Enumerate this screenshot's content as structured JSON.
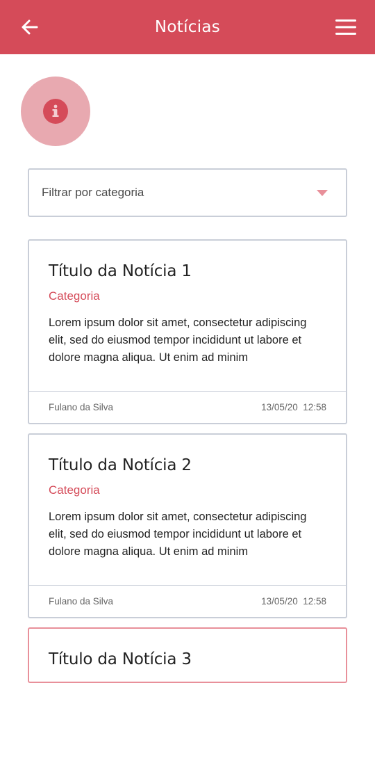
{
  "header": {
    "title": "Notícias",
    "back_icon": "arrow-left-icon",
    "menu_icon": "hamburger-menu-icon",
    "color": "#d54b59"
  },
  "info_button": {
    "icon": "info-icon"
  },
  "filter": {
    "placeholder": "Filtrar por categoria",
    "icon": "caret-down-icon"
  },
  "news": [
    {
      "title": "Título da Notícia 1",
      "category": "Categoria",
      "excerpt": "Lorem ipsum dolor sit amet, consectetur adipiscing elit, sed do eiusmod tempor incididunt ut labore et dolore magna aliqua. Ut enim ad minim",
      "author": "Fulano da Silva",
      "date": "13/05/20  12:58"
    },
    {
      "title": "Título da Notícia 2",
      "category": "Categoria",
      "excerpt": "Lorem ipsum dolor sit amet, consectetur adipiscing elit, sed do eiusmod tempor incididunt ut labore et dolore magna aliqua. Ut enim ad minim",
      "author": "Fulano da Silva",
      "date": "13/05/20  12:58"
    },
    {
      "title": "Título da Notícia 3"
    }
  ]
}
